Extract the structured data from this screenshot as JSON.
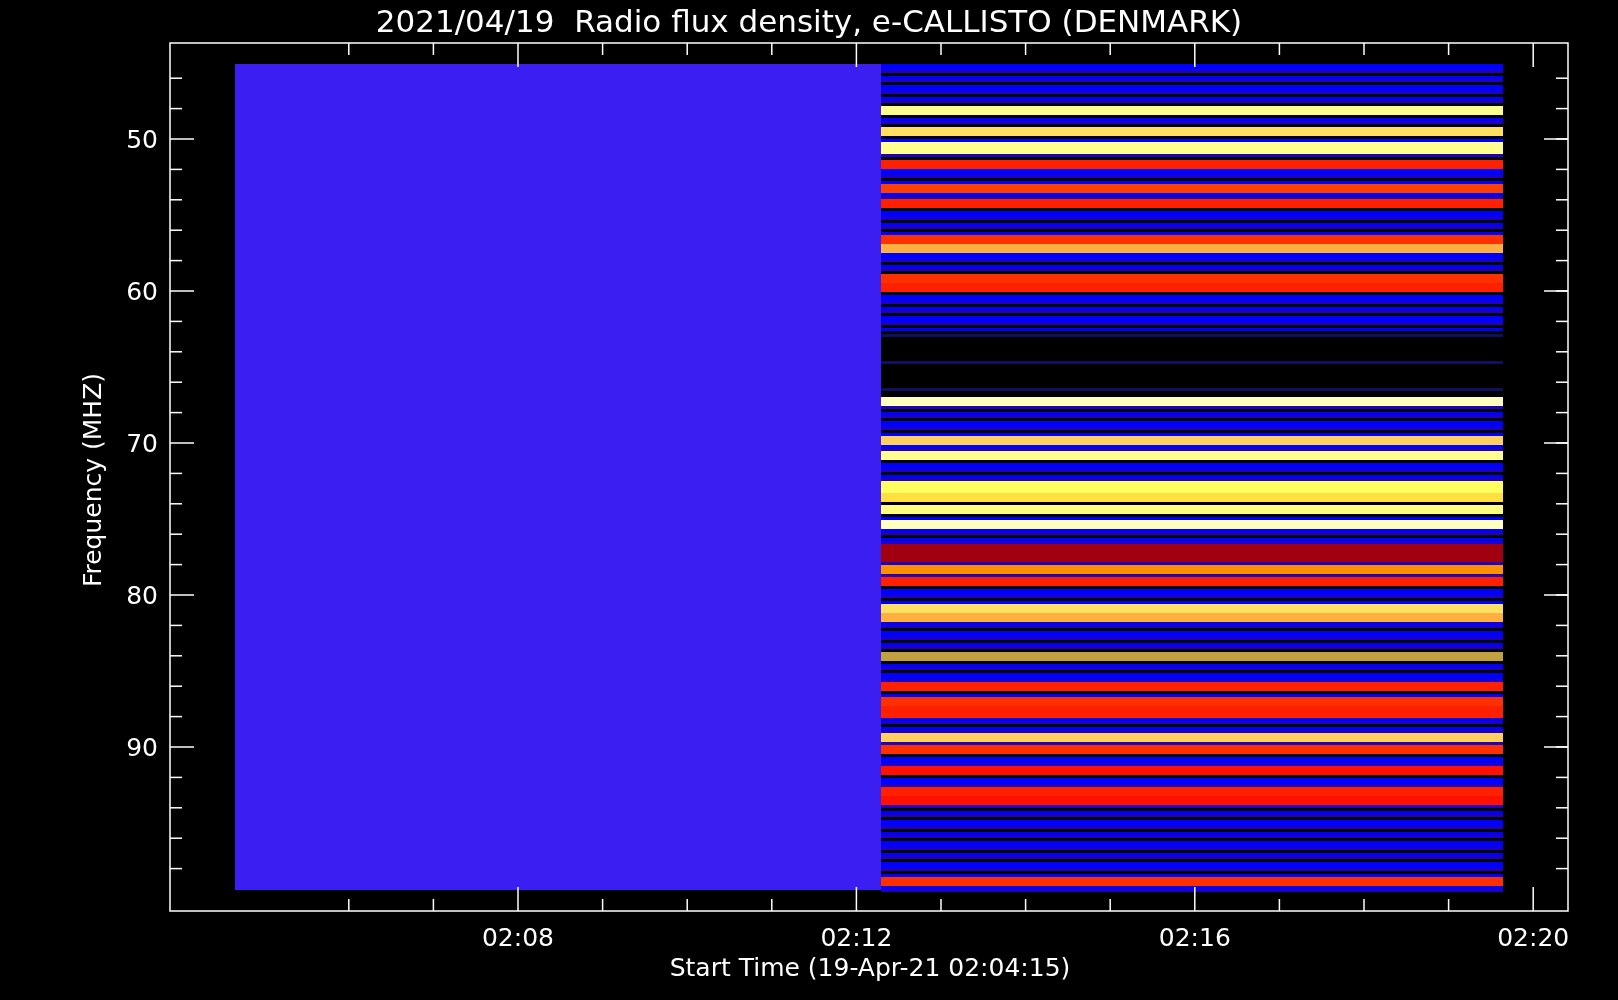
{
  "title": "2021/04/19  Radio flux density, e-CALLISTO (DENMARK)",
  "y_axis": {
    "label": "Frequency (MHZ)",
    "ticks": [
      "50",
      "60",
      "70",
      "80",
      "90"
    ]
  },
  "x_axis": {
    "label": "Start Time (19-Apr-21 02:04:15)",
    "ticks": [
      "02:08",
      "02:12",
      "02:16",
      "02:20"
    ]
  }
}
